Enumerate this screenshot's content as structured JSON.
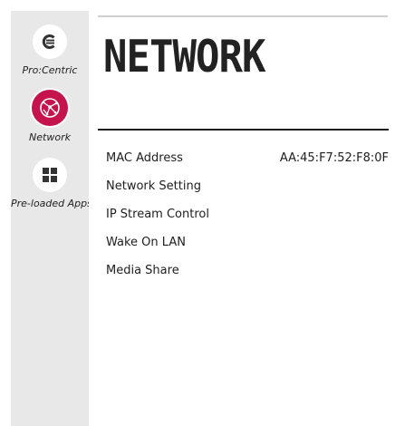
{
  "sidebar": {
    "items": [
      {
        "label": "Pro:Centric",
        "icon": "procentric-icon",
        "active": false
      },
      {
        "label": "Network",
        "icon": "network-globe-icon",
        "active": true
      },
      {
        "label": "Pre-loaded Apps",
        "icon": "apps-grid-icon",
        "active": false
      }
    ]
  },
  "main": {
    "title": "NETWORK",
    "menu": [
      {
        "label": "MAC Address",
        "value": "AA:45:F7:52:F8:0F"
      },
      {
        "label": "Network Setting"
      },
      {
        "label": "IP Stream Control"
      },
      {
        "label": "Wake On LAN"
      },
      {
        "label": "Media Share"
      }
    ]
  },
  "colors": {
    "accent": "#c4134d",
    "sidebar_bg": "#e8e8e8",
    "text": "#1e1e1e"
  }
}
